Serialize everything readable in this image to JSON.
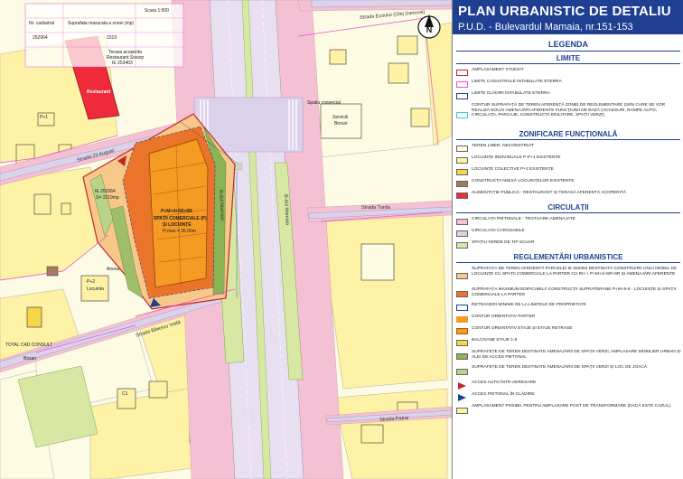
{
  "title": {
    "line1": "PLAN URBANISTIC DE DETALIU",
    "line2": "P.U.D. - Bulevardul Mamaia, nr.151-153"
  },
  "colors": {
    "title_bg": "#1f3f93",
    "residential": "#fdf2a6",
    "collective": "#f5d54a",
    "commercial": "#ee2a3b",
    "pedestrian": "#f3c1d3",
    "road": "#dcd1ea",
    "green": "#d8e8a4",
    "study_area": "#f59a23",
    "built_zone": "#e9742a"
  },
  "map": {
    "streets": [
      {
        "key": "s1",
        "label": "Strada Ecoului (Olej Danovai)"
      },
      {
        "key": "s2",
        "label": "Strada 23 August"
      },
      {
        "key": "s3",
        "label": "B-dul Mamaia"
      },
      {
        "key": "s4",
        "label": "B-dul Mamaia"
      },
      {
        "key": "s5",
        "label": "Strada Turda"
      },
      {
        "key": "s6",
        "label": "Strada Bibescu Vodă"
      },
      {
        "key": "s7",
        "label": "Strada Patrai"
      }
    ],
    "labels": [
      {
        "key": "m1",
        "text": "Scara 1:500"
      },
      {
        "key": "m2",
        "text": "Nr. cadastral"
      },
      {
        "key": "m3",
        "text": "Suprafata masurata a zonei (mp)"
      },
      {
        "key": "m4",
        "text": "252064"
      },
      {
        "key": "m5",
        "text": "1519"
      },
      {
        "key": "m6",
        "text": "Terasa acoperita"
      },
      {
        "key": "m7",
        "text": "Restaurant Sosiop"
      },
      {
        "key": "m8",
        "text": "IE 253403"
      },
      {
        "key": "m9",
        "text": "Restaurant"
      },
      {
        "key": "m10",
        "text": "SPAȚII COMERCIALE (P)"
      },
      {
        "key": "m11",
        "text": "ȘI LOCUINȚE"
      },
      {
        "key": "m12",
        "text": "P+M+4+5R+6R"
      },
      {
        "key": "m13",
        "text": "H max = 36.00m"
      },
      {
        "key": "m14",
        "text": "Anexa"
      },
      {
        "key": "m15",
        "text": "Spatiu comercial"
      },
      {
        "key": "m16",
        "text": "Serviciii"
      },
      {
        "key": "m17",
        "text": "Birouri"
      },
      {
        "key": "m18",
        "text": "Locuinta"
      },
      {
        "key": "m19",
        "text": "TOTAL CAD CONSULT"
      },
      {
        "key": "m20",
        "text": "Boxan"
      },
      {
        "key": "m21",
        "text": "IE 252064"
      },
      {
        "key": "m22",
        "text": "S= 1519mp"
      },
      {
        "key": "m23",
        "text": "P+1"
      },
      {
        "key": "m24",
        "text": "P+2"
      },
      {
        "key": "m25",
        "text": "C1"
      }
    ]
  },
  "legend": {
    "title": "LEGENDA",
    "sections": [
      {
        "key": "limite",
        "title": "LIMITE",
        "items": [
          {
            "text": "AMPLASAMENT STUDIAT",
            "fill": "#ffffff",
            "border": "#c0262d"
          },
          {
            "text": "LIMITE CADASTRALE INTABULATE ETERRA",
            "fill": "#ffffff",
            "border": "#e64fd3"
          },
          {
            "text": "LIMITE CLĂDIRI INTABULATE ETERRA",
            "fill": "#ffffff",
            "border": "#1f3f93"
          },
          {
            "text": "CONTUR SUPRAFAȚĂ DE TEREN AFERENTĂ ZONEI DE REGLEMENTARE 15/IN CARE SE VOR REALIZA NOUAI AMENAJĂRI AFERENTE FUNCȚIUNII DE BAZĂ (ACCESURI, RAMPE AUTO, CIRCULAȚII, PARCAJE, CONSTRUCȚII EDILITARE, SPAȚII VERZI)",
            "fill": "#ffffff",
            "border": "#42c8e6"
          }
        ]
      },
      {
        "key": "zonificare",
        "title": "ZONIFICARE FUNCȚIONALĂ",
        "items": [
          {
            "text": "TEREN LIBER, NECONSTRUIT",
            "fill": "#fdfbe1",
            "border": "#666666"
          },
          {
            "text": "LOCUINȚE INDIVIDUALE P-P+1 EXISTENTE",
            "fill": "#fdf2a6",
            "border": "#666666"
          },
          {
            "text": "LOCUINȚE COLECTIVE P+2 EXISTENTE",
            "fill": "#f5d54a",
            "border": "#666666"
          },
          {
            "text": "CONSTRUCȚII ANEXĂ LOCUINȚELOR EXISTENTE",
            "fill": "#a27d5b",
            "border": "#666666"
          },
          {
            "text": "ALIMENTAȚIE PUBLICĂ - RESTAURANT ȘI TERASĂ AFERENTĂ ACOPERITĂ",
            "fill": "#ee2a3b",
            "border": "#666666"
          }
        ]
      },
      {
        "key": "circulatii",
        "title": "CIRCULAȚII",
        "items": [
          {
            "text": "CIRCULAȚII PIETONALE - TROTUARE AMENAJATE",
            "fill": "#f3c1d3",
            "border": "#666666"
          },
          {
            "text": "CIRCULAȚII CAROSABILE",
            "fill": "#dcd1ea",
            "border": "#666666"
          },
          {
            "text": "SPAȚIU VERDE DE TIP SCUAR",
            "fill": "#d8e8a4",
            "border": "#666666"
          }
        ]
      },
      {
        "key": "reglementari",
        "title": "REGLEMENTĂRI URBANISTICE",
        "items": [
          {
            "text": "SUPRAFAȚA DE TEREN AFERENTĂ PARCELEI IE 252064 DESTINATĂ CONSTRUIRII UNUI IMOBIL DE LOCUINȚE CU SPAȚII COMERCIALE LA PARTER CU RH + P+M+4+5R+6R ȘI AMENAJĂRI AFERENTE",
            "fill": "#f7c88a",
            "border": "#666666"
          },
          {
            "text": "SUPRAFAȚA MAXIMUM EDIFICABILĂ CONSTRUCȚII SUPRATERANE P+M+5-6 - LOCUINȚE ȘI SPAȚII COMERCIALE LA PARTER",
            "fill": "#e9742a",
            "border": "#666666"
          },
          {
            "text": "RETRAGERI MINIME DE LA LIMITELE DE PROPRIETATE",
            "fill": "#ffffff",
            "border": "#1f3f93"
          },
          {
            "text": "CONTUR ORIENTATIV PARTER",
            "fill": "#f59a23",
            "border": "#f59a23"
          },
          {
            "text": "CONTUR ORIENTATIV ETAJE ȘI ETAJE RETRASE",
            "fill": "#f59a23",
            "border": "#b35b00"
          },
          {
            "text": "BALCOANE ETAJE 1-6",
            "fill": "#f5d54a",
            "border": "#666666"
          },
          {
            "text": "SUPRAFEȚE DE TEREN DESTINATE AMENAJĂRII DE SPAȚII VERZI, AMPLASARE MOBILIER URBAN ȘI ALEI DE ACCES PIETONAL",
            "fill": "#8ab454",
            "border": "#666666"
          },
          {
            "text": "SUPRAFEȚE DE TEREN DESTINATE AMENAJĂRII DE SPAȚII VERZI ȘI LOC DE JOACĂ",
            "fill": "#b9d48a",
            "border": "#666666"
          },
          {
            "text": "ACCES AUTO ÎNTR-ADRESARE",
            "fill": "#ffffff",
            "border": "#ffffff"
          },
          {
            "text": "ACCES PIETONAL ÎN CLĂDIRE",
            "fill": "#ffffff",
            "border": "#ffffff"
          },
          {
            "text": "AMPLASAMENT POSIBIL PENTRU AMPLASARE POST DE TRANSFORMARE (DACĂ ESTE CAZUL)",
            "fill": "#fdf2a6",
            "border": "#666666"
          }
        ]
      }
    ]
  }
}
